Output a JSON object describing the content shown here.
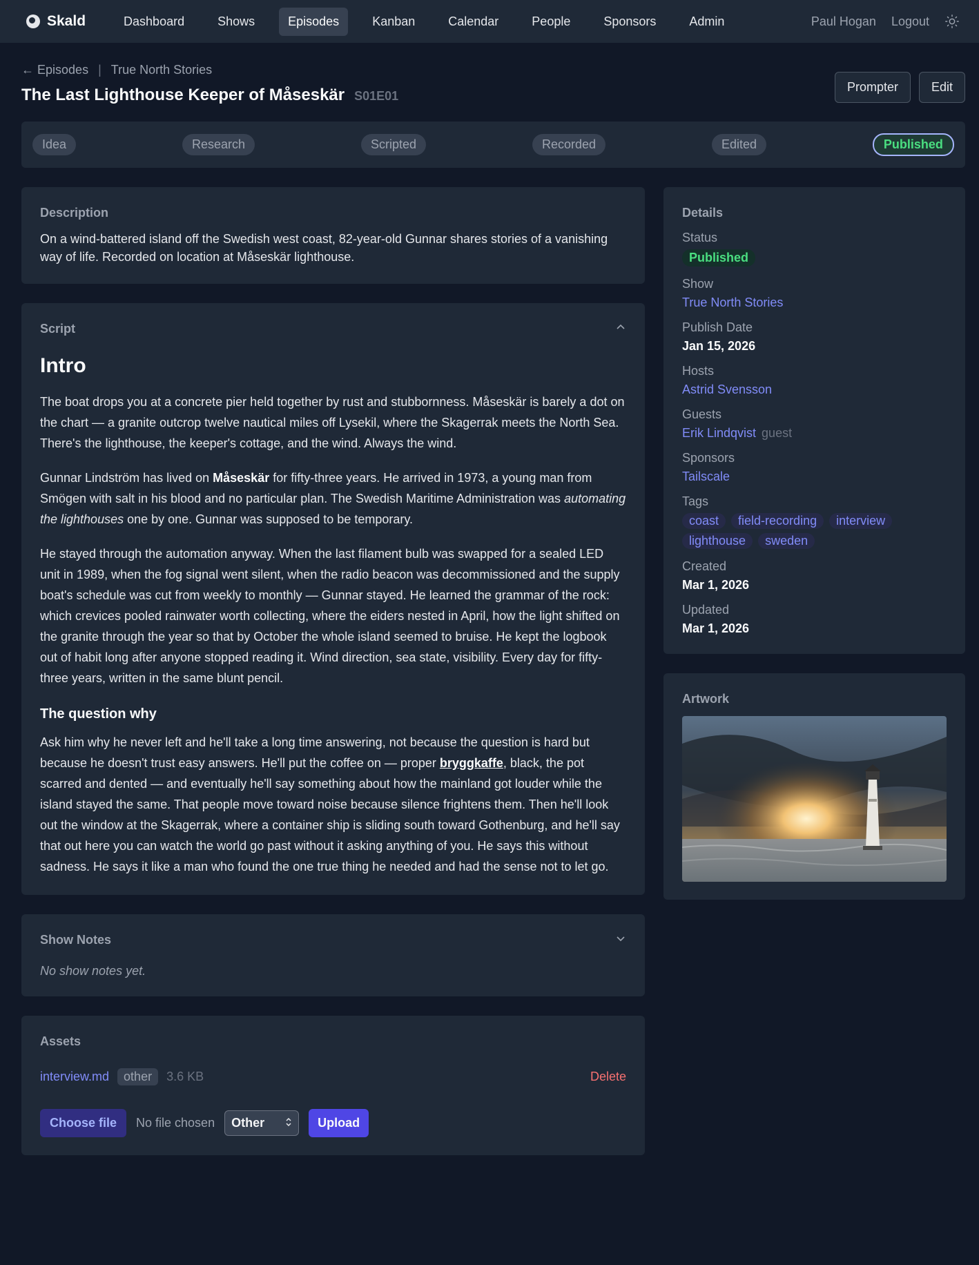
{
  "nav": {
    "brand": "Skald",
    "links": [
      "Dashboard",
      "Shows",
      "Episodes",
      "Kanban",
      "Calendar",
      "People",
      "Sponsors",
      "Admin"
    ],
    "active": "Episodes",
    "user": "Paul Hogan",
    "logout": "Logout",
    "theme_icon": "sun-icon"
  },
  "breadcrumb": {
    "back": "Episodes",
    "show": "True North Stories"
  },
  "episode": {
    "title": "The Last Lighthouse Keeper of Måseskär",
    "code": "S01E01"
  },
  "actions": {
    "prompter": "Prompter",
    "edit": "Edit"
  },
  "pipeline": {
    "stages": [
      "Idea",
      "Research",
      "Scripted",
      "Recorded",
      "Edited",
      "Published"
    ],
    "current": "Published"
  },
  "description": {
    "label": "Description",
    "text": "On a wind-battered island off the Swedish west coast, 82-year-old Gunnar shares stories of a vanishing way of life. Recorded on location at Måseskär lighthouse."
  },
  "script": {
    "label": "Script",
    "h1": "Intro",
    "p1": "The boat drops you at a concrete pier held together by rust and stubbornness. Måseskär is barely a dot on the chart — a granite outcrop twelve nautical miles off Lysekil, where the Skagerrak meets the North Sea. There's the lighthouse, the keeper's cottage, and the wind. Always the wind.",
    "p2_a": "Gunnar Lindström has lived on ",
    "p2_b": "Måseskär",
    "p2_c": " for fifty-three years. He arrived in 1973, a young man from Smögen with salt in his blood and no particular plan. The Swedish Maritime Administration was ",
    "p2_d": "automating the lighthouses",
    "p2_e": " one by one. Gunnar was supposed to be temporary.",
    "p3": "He stayed through the automation anyway. When the last filament bulb was swapped for a sealed LED unit in 1989, when the fog signal went silent, when the radio beacon was decommissioned and the supply boat's schedule was cut from weekly to monthly — Gunnar stayed. He learned the grammar of the rock: which crevices pooled rainwater worth collecting, where the eiders nested in April, how the light shifted on the granite through the year so that by October the whole island seemed to bruise. He kept the logbook out of habit long after anyone stopped reading it. Wind direction, sea state, visibility. Every day for fifty-three years, written in the same blunt pencil.",
    "h3": "The question why",
    "p4_a": "Ask him why he never left and he'll take a long time answering, not because the question is hard but because he doesn't trust easy answers. He'll put the coffee on — proper ",
    "p4_b": "bryggkaffe",
    "p4_c": ", black, the pot scarred and dented — and eventually he'll say something about how the mainland got louder while the island stayed the same. That people move toward noise because silence frightens them. Then he'll look out the window at the Skagerrak, where a container ship is sliding south toward Gothenburg, and he'll say that out here you can watch the world go past without it asking anything of you. He says this without sadness. He says it like a man who found the one true thing he needed and had the sense not to let go."
  },
  "show_notes": {
    "label": "Show Notes",
    "empty": "No show notes yet."
  },
  "assets": {
    "label": "Assets",
    "items": [
      {
        "name": "interview.md",
        "type": "other",
        "size": "3.6 KB",
        "delete": "Delete"
      }
    ],
    "choose_file": "Choose file",
    "no_file": "No file chosen",
    "type_select": "Other",
    "upload": "Upload"
  },
  "details": {
    "label": "Details",
    "status_label": "Status",
    "status": "Published",
    "show_label": "Show",
    "show": "True North Stories",
    "publish_label": "Publish Date",
    "publish": "Jan 15, 2026",
    "hosts_label": "Hosts",
    "host": "Astrid Svensson",
    "guests_label": "Guests",
    "guest": "Erik Lindqvist",
    "guest_role": "guest",
    "sponsors_label": "Sponsors",
    "sponsor": "Tailscale",
    "tags_label": "Tags",
    "tags": [
      "coast",
      "field-recording",
      "interview",
      "lighthouse",
      "sweden"
    ],
    "created_label": "Created",
    "created": "Mar 1, 2026",
    "updated_label": "Updated",
    "updated": "Mar 1, 2026"
  },
  "artwork": {
    "label": "Artwork"
  },
  "colors": {
    "accent": "#818cf8",
    "success": "#4ade80",
    "danger": "#f87171",
    "bg": "#111827",
    "card": "#1f2937"
  }
}
